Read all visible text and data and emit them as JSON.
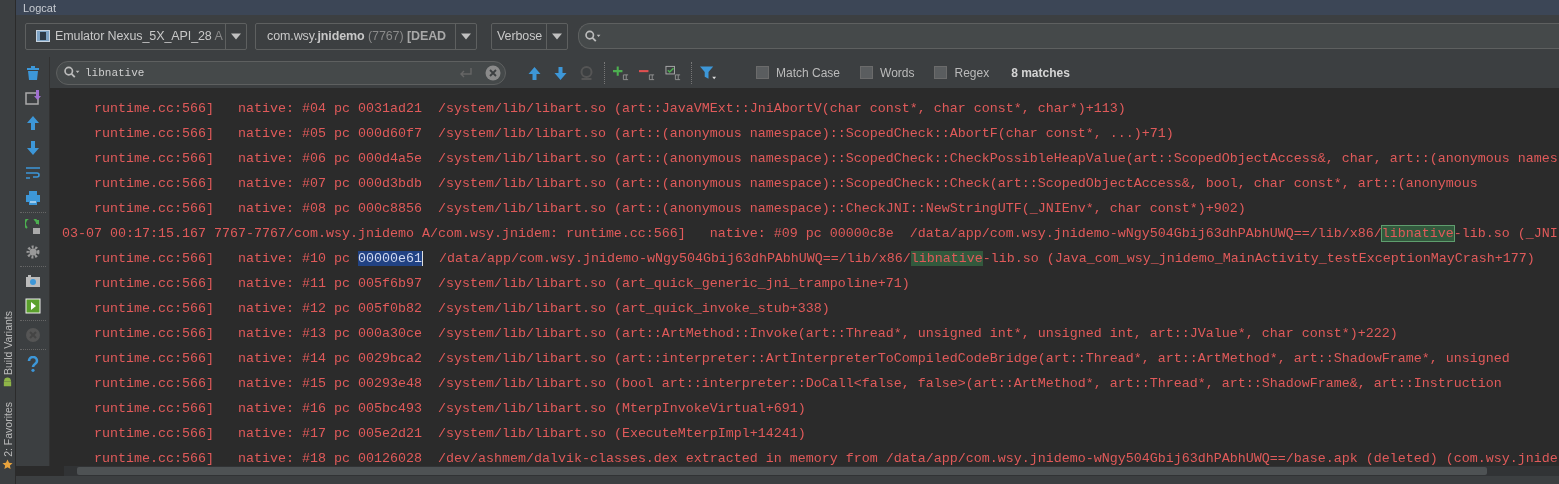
{
  "window": {
    "title": "Logcat"
  },
  "side_tabs": [
    {
      "label": "Build Variants",
      "kind": "android"
    },
    {
      "label": "2: Favorites",
      "kind": "star"
    }
  ],
  "device_dropdown": {
    "name": "Emulator Nexus_5X_API_28",
    "detail": "A"
  },
  "process_dropdown": {
    "package": "com.wsy.",
    "app": "jnidemo",
    "pid": "(7767)",
    "status": "[DEAD"
  },
  "level_dropdown": {
    "value": "Verbose"
  },
  "filter": {
    "value": "libnative"
  },
  "search_options": [
    {
      "label": "Match Case",
      "checked": false
    },
    {
      "label": "Words",
      "checked": false
    },
    {
      "label": "Regex",
      "checked": false
    }
  ],
  "match_count": "8 matches",
  "log_lines": [
    {
      "indented": true,
      "parts": [
        {
          "text": "runtime.cc:566]   native: #04 pc 0031ad21  /system/lib/libart.so (art::JavaVMExt::JniAbortV(char const*, char const*, char*)+113)",
          "kind": "plain"
        }
      ]
    },
    {
      "indented": true,
      "parts": [
        {
          "text": "runtime.cc:566]   native: #05 pc 000d60f7  /system/lib/libart.so (art::(anonymous namespace)::ScopedCheck::AbortF(char const*, ...)+71)",
          "kind": "plain"
        }
      ]
    },
    {
      "indented": true,
      "parts": [
        {
          "text": "runtime.cc:566]   native: #06 pc 000d4a5e  /system/lib/libart.so (art::(anonymous namespace)::ScopedCheck::CheckPossibleHeapValue(art::ScopedObjectAccess&, char, art::(anonymous names",
          "kind": "plain"
        }
      ]
    },
    {
      "indented": true,
      "parts": [
        {
          "text": "runtime.cc:566]   native: #07 pc 000d3bdb  /system/lib/libart.so (art::(anonymous namespace)::ScopedCheck::Check(art::ScopedObjectAccess&, bool, char const*, art::(anonymous",
          "kind": "plain"
        }
      ]
    },
    {
      "indented": true,
      "parts": [
        {
          "text": "runtime.cc:566]   native: #08 pc 000c8856  /system/lib/libart.so (art::(anonymous namespace)::CheckJNI::NewStringUTF(_JNIEnv*, char const*)+902)",
          "kind": "plain"
        }
      ]
    },
    {
      "indented": false,
      "parts": [
        {
          "text": "03-07 00:17:15.167 7767-7767/com.wsy.jnidemo A/com.wsy.jnidem: runtime.cc:566]   native: #09 pc 00000c8e  /data/app/com.wsy.jnidemo-wNgy504Gbij63dhPAbhUWQ==/lib/x86/",
          "kind": "plain"
        },
        {
          "text": "libnative",
          "kind": "current-match"
        },
        {
          "text": "-lib.so (_JNI",
          "kind": "plain"
        }
      ]
    },
    {
      "indented": true,
      "parts": [
        {
          "text": "runtime.cc:566]   native: #10 pc ",
          "kind": "plain"
        },
        {
          "text": "00000e61",
          "kind": "selection"
        },
        {
          "text": "  /data/app/com.wsy.jnidemo-wNgy504Gbij63dhPAbhUWQ==/lib/x86/",
          "kind": "plain"
        },
        {
          "text": "libnative",
          "kind": "match"
        },
        {
          "text": "-lib.so (Java_com_wsy_jnidemo_MainActivity_testExceptionMayCrash+177)",
          "kind": "plain"
        }
      ]
    },
    {
      "indented": true,
      "parts": [
        {
          "text": "runtime.cc:566]   native: #11 pc 005f6b97  /system/lib/libart.so (art_quick_generic_jni_trampoline+71)",
          "kind": "plain"
        }
      ]
    },
    {
      "indented": true,
      "parts": [
        {
          "text": "runtime.cc:566]   native: #12 pc 005f0b82  /system/lib/libart.so (art_quick_invoke_stub+338)",
          "kind": "plain"
        }
      ]
    },
    {
      "indented": true,
      "parts": [
        {
          "text": "runtime.cc:566]   native: #13 pc 000a30ce  /system/lib/libart.so (art::ArtMethod::Invoke(art::Thread*, unsigned int*, unsigned int, art::JValue*, char const*)+222)",
          "kind": "plain"
        }
      ]
    },
    {
      "indented": true,
      "parts": [
        {
          "text": "runtime.cc:566]   native: #14 pc 0029bca2  /system/lib/libart.so (art::interpreter::ArtInterpreterToCompiledCodeBridge(art::Thread*, art::ArtMethod*, art::ShadowFrame*, unsigned",
          "kind": "plain"
        }
      ]
    },
    {
      "indented": true,
      "parts": [
        {
          "text": "runtime.cc:566]   native: #15 pc 00293e48  /system/lib/libart.so (bool art::interpreter::DoCall<false, false>(art::ArtMethod*, art::Thread*, art::ShadowFrame&, art::Instruction",
          "kind": "plain"
        }
      ]
    },
    {
      "indented": true,
      "parts": [
        {
          "text": "runtime.cc:566]   native: #16 pc 005bc493  /system/lib/libart.so (MterpInvokeVirtual+691)",
          "kind": "plain"
        }
      ]
    },
    {
      "indented": true,
      "parts": [
        {
          "text": "runtime.cc:566]   native: #17 pc 005e2d21  /system/lib/libart.so (ExecuteMterpImpl+14241)",
          "kind": "plain"
        }
      ]
    },
    {
      "indented": true,
      "parts": [
        {
          "text": "runtime.cc:566]   native: #18 pc 00126028  /dev/ashmem/dalvik-classes.dex extracted in memory from /data/app/com.wsy.jnidemo-wNgy504Gbij63dhPAbhUWQ==/base.apk (deleted) (com.wsy.jnide",
          "kind": "plain"
        }
      ]
    }
  ]
}
